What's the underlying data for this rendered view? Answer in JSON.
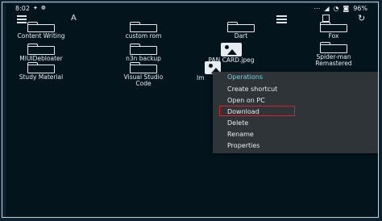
{
  "statusbar": {
    "time": "8:02",
    "battery": "96%"
  },
  "toolbar": {
    "sort_label": "A"
  },
  "items": [
    {
      "label": "Content Writing",
      "label2": ""
    },
    {
      "label": "custom rom",
      "label2": ""
    },
    {
      "label": "Dart",
      "label2": ""
    },
    {
      "label": "Fox",
      "label2": ""
    },
    {
      "label": "MIUIDebloater",
      "label2": ""
    },
    {
      "label": "n3n backup",
      "label2": ""
    },
    {
      "label": "PAN CARD.jpeg",
      "label2": ""
    },
    {
      "label": "Spider-man",
      "label2": "Remastered"
    },
    {
      "label": "Study Material",
      "label2": ""
    },
    {
      "label": "Visual Studio",
      "label2": "Code"
    },
    {
      "label": "Im",
      "label2": ""
    }
  ],
  "context_menu": {
    "title": "Operations",
    "items": [
      "Create shortcut",
      "Open on PC",
      "Download",
      "Delete",
      "Rename",
      "Properties"
    ]
  },
  "colors": {
    "background": "#04141d",
    "menu_background": "#2e3438",
    "menu_title": "#6fd4e8",
    "highlight": "#d8242c"
  }
}
